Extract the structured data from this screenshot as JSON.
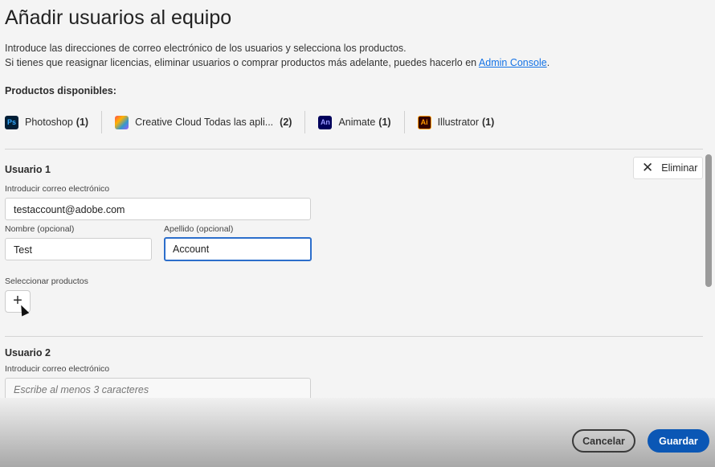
{
  "title": "Añadir usuarios al equipo",
  "intro": {
    "line1": "Introduce las direcciones de correo electrónico de los usuarios y selecciona los productos.",
    "line2": "Si tienes que reasignar licencias, eliminar usuarios o comprar productos más adelante, puedes hacerlo en ",
    "link": "Admin Console",
    "tail": "."
  },
  "products_label": "Productos disponibles:",
  "products": [
    {
      "name": "Photoshop",
      "count": "(1)",
      "icon": "Ps",
      "color": "#001e36",
      "fg": "#31a8ff"
    },
    {
      "name": "Creative Cloud Todas las apli...",
      "count": "(2)",
      "icon": "cc",
      "color": "#ff4f4f"
    },
    {
      "name": "Animate",
      "count": "(1)",
      "icon": "An",
      "color": "#00005b",
      "fg": "#9999ff"
    },
    {
      "name": "Illustrator",
      "count": "(1)",
      "icon": "Ai",
      "color": "#330000",
      "fg": "#ff9a00"
    }
  ],
  "user1": {
    "label": "Usuario 1",
    "remove": "Eliminar",
    "email_label": "Introducir correo electrónico",
    "email": "testaccount@adobe.com",
    "first_label": "Nombre (opcional)",
    "first": "Test",
    "last_label": "Apellido (opcional)",
    "last": "Account",
    "products_label": "Seleccionar productos"
  },
  "user2": {
    "label": "Usuario 2",
    "email_label": "Introducir correo electrónico",
    "email_placeholder": "Escribe al menos 3 caracteres"
  },
  "footer": {
    "cancel": "Cancelar",
    "save": "Guardar"
  }
}
